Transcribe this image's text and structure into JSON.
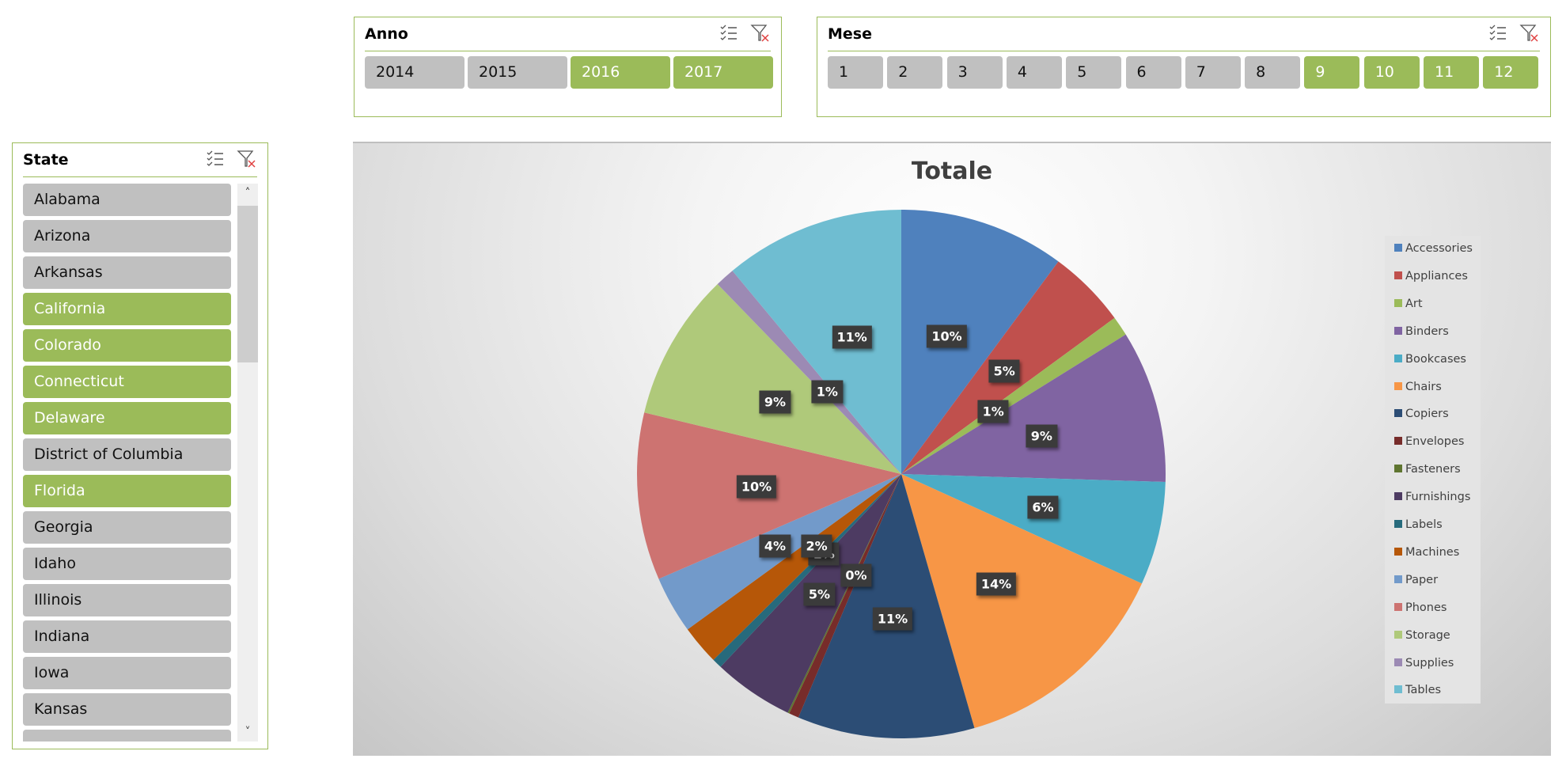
{
  "slicers": {
    "anno": {
      "title": "Anno",
      "items": [
        {
          "label": "2014",
          "selected": false
        },
        {
          "label": "2015",
          "selected": false
        },
        {
          "label": "2016",
          "selected": true
        },
        {
          "label": "2017",
          "selected": true
        }
      ]
    },
    "mese": {
      "title": "Mese",
      "items": [
        {
          "label": "1",
          "selected": false
        },
        {
          "label": "2",
          "selected": false
        },
        {
          "label": "3",
          "selected": false
        },
        {
          "label": "4",
          "selected": false
        },
        {
          "label": "5",
          "selected": false
        },
        {
          "label": "6",
          "selected": false
        },
        {
          "label": "7",
          "selected": false
        },
        {
          "label": "8",
          "selected": false
        },
        {
          "label": "9",
          "selected": true
        },
        {
          "label": "10",
          "selected": true
        },
        {
          "label": "11",
          "selected": true
        },
        {
          "label": "12",
          "selected": true
        }
      ]
    },
    "state": {
      "title": "State",
      "items": [
        {
          "label": "Alabama",
          "selected": false
        },
        {
          "label": "Arizona",
          "selected": false
        },
        {
          "label": "Arkansas",
          "selected": false
        },
        {
          "label": "California",
          "selected": true
        },
        {
          "label": "Colorado",
          "selected": true
        },
        {
          "label": "Connecticut",
          "selected": true
        },
        {
          "label": "Delaware",
          "selected": true
        },
        {
          "label": "District of Columbia",
          "selected": false
        },
        {
          "label": "Florida",
          "selected": true
        },
        {
          "label": "Georgia",
          "selected": false
        },
        {
          "label": "Idaho",
          "selected": false
        },
        {
          "label": "Illinois",
          "selected": false
        },
        {
          "label": "Indiana",
          "selected": false
        },
        {
          "label": "Iowa",
          "selected": false
        },
        {
          "label": "Kansas",
          "selected": false
        },
        {
          "label": "",
          "selected": false
        }
      ],
      "scroll_up": "˄",
      "scroll_down": "˅"
    }
  },
  "icons": {
    "multi_select": "multi-select-icon",
    "clear_filter": "clear-filter-icon"
  },
  "colors": {
    "accent": "#9bbb59",
    "unselected": "#c0c0c0",
    "label_bg": "#3b3b3b"
  },
  "chart_data": {
    "type": "pie",
    "title": "Totale",
    "legend_position": "right",
    "categories": [
      "Accessories",
      "Appliances",
      "Art",
      "Binders",
      "Bookcases",
      "Chairs",
      "Copiers",
      "Envelopes",
      "Fasteners",
      "Furnishings",
      "Labels",
      "Machines",
      "Paper",
      "Phones",
      "Storage",
      "Supplies",
      "Tables"
    ],
    "values": [
      10.1,
      4.8,
      1.2,
      9.3,
      6.3,
      13.7,
      10.8,
      0.6,
      0.1,
      4.9,
      0.6,
      2.4,
      3.5,
      10.2,
      9.0,
      1.2,
      11.0
    ],
    "labels": [
      "10%",
      "5%",
      "1%",
      "9%",
      "6%",
      "14%",
      "11%",
      "0%",
      "0%",
      "5%",
      "1%",
      "2%",
      "4%",
      "10%",
      "9%",
      "1%",
      "11%"
    ],
    "colors": [
      "#4f81bd",
      "#c0504d",
      "#9bbb59",
      "#8064a2",
      "#4bacc6",
      "#f79646",
      "#2c4d75",
      "#772c2a",
      "#5f7530",
      "#4d3b62",
      "#276a7c",
      "#b65708",
      "#729aca",
      "#cd7371",
      "#afc97a",
      "#9c8ab4",
      "#6fbdd1"
    ]
  }
}
